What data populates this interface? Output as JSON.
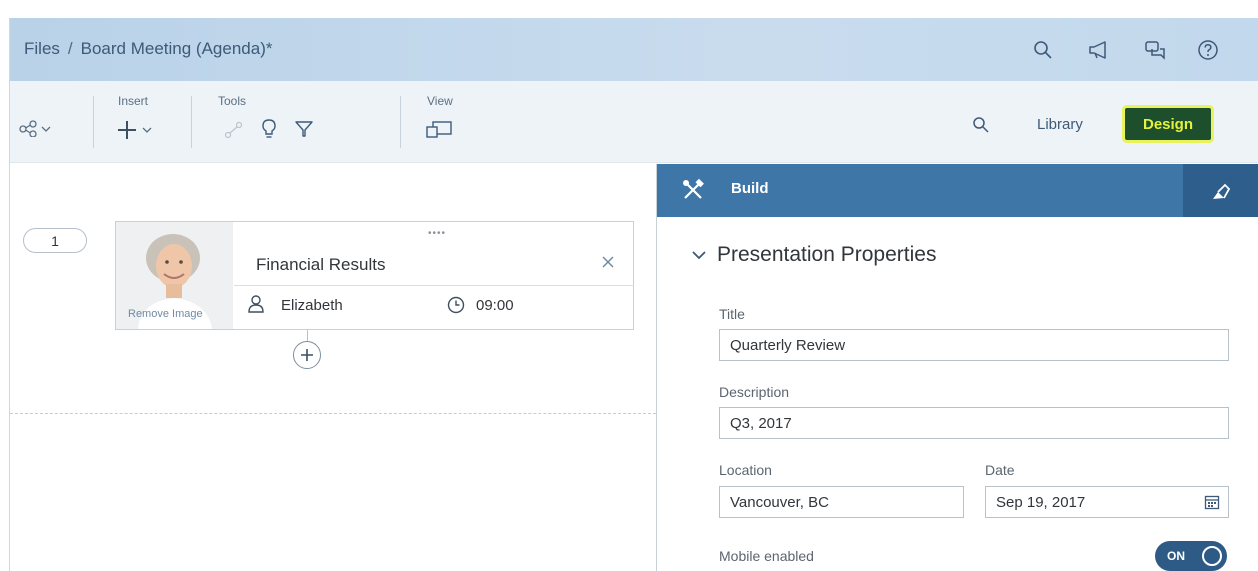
{
  "shell": {
    "breadcrumb_root": "Files",
    "breadcrumb_separator": "/",
    "breadcrumb_current": "Board Meeting (Agenda)*",
    "icons": [
      "search-icon",
      "megaphone-icon",
      "chat-icon",
      "help-icon"
    ]
  },
  "toolbar": {
    "insert_label": "Insert",
    "tools_label": "Tools",
    "view_label": "View",
    "library_label": "Library",
    "design_label": "Design"
  },
  "agenda": {
    "item_number": "1",
    "item_title": "Financial Results",
    "remove_image_label": "Remove Image",
    "presenter": "Elizabeth",
    "time": "09:00",
    "grip": "••••"
  },
  "panel": {
    "header_label": "Build",
    "section_title": "Presentation Properties",
    "title_label": "Title",
    "title_value": "Quarterly Review",
    "description_label": "Description",
    "description_value": "Q3, 2017",
    "location_label": "Location",
    "location_value": "Vancouver, BC",
    "date_label": "Date",
    "date_value": "Sep 19, 2017",
    "mobile_label": "Mobile enabled",
    "mobile_toggle": "ON"
  },
  "colors": {
    "shell_bg": "#c2d8ec",
    "panel_header": "#3f76a8",
    "design_button_bg": "#1d4f2c",
    "design_highlight": "#e9f35b"
  }
}
